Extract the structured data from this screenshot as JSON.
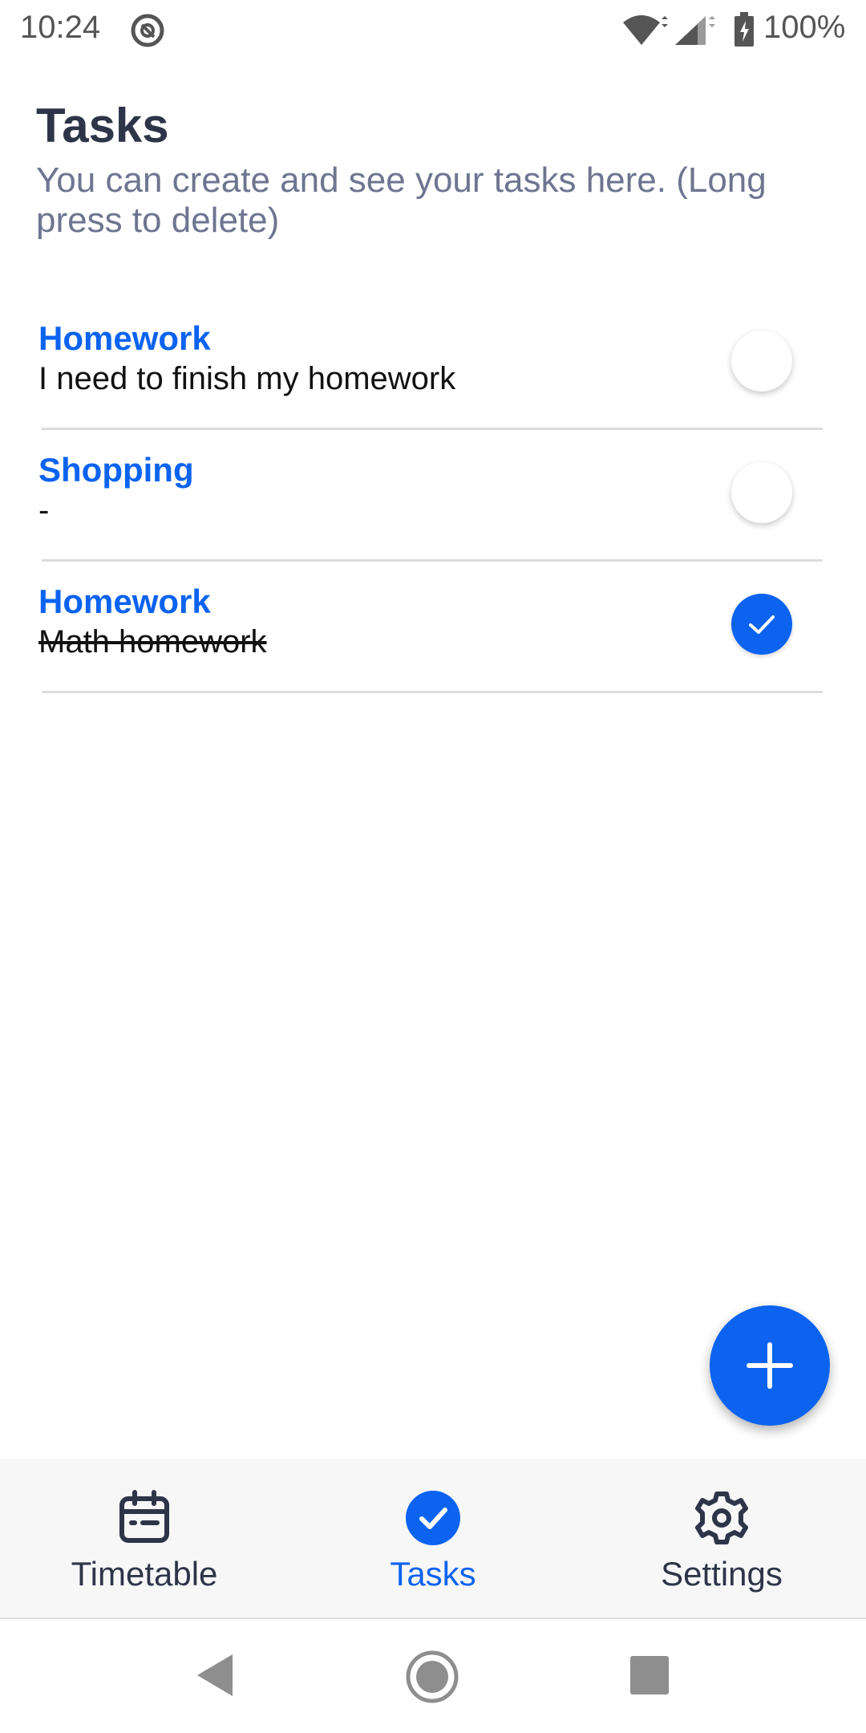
{
  "status_bar": {
    "time": "10:24",
    "battery": "100%"
  },
  "header": {
    "title": "Tasks",
    "subtitle": "You can create and see your tasks here. (Long press to delete)"
  },
  "tasks": [
    {
      "title": "Homework",
      "description": "I need to finish my homework",
      "completed": false
    },
    {
      "title": "Shopping",
      "description": "-",
      "completed": false
    },
    {
      "title": "Homework",
      "description": "Math homework",
      "completed": true
    }
  ],
  "bottom_nav": {
    "items": [
      {
        "label": "Timetable",
        "icon": "calendar-icon",
        "active": false
      },
      {
        "label": "Tasks",
        "icon": "check-circle-icon",
        "active": true
      },
      {
        "label": "Settings",
        "icon": "gear-icon",
        "active": false
      }
    ]
  },
  "colors": {
    "accent": "#0b63f0",
    "title": "#2e3549",
    "subtitle": "#6e7590"
  }
}
